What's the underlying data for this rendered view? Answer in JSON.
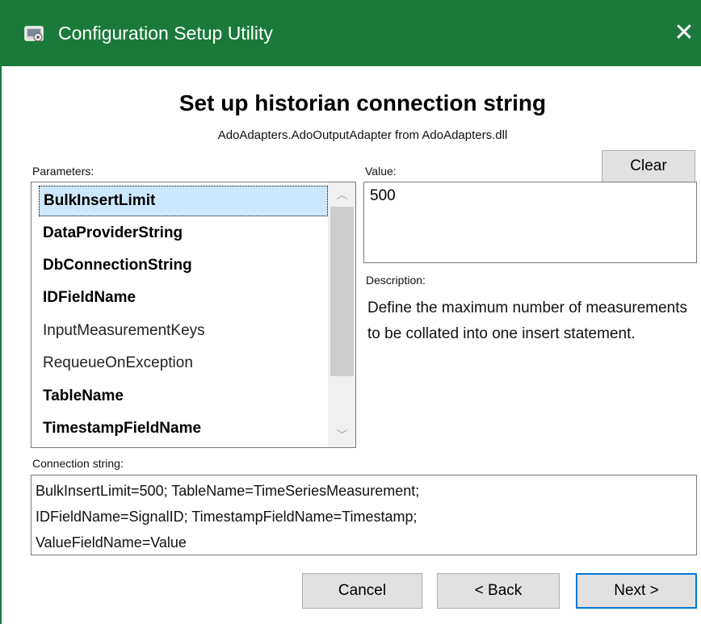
{
  "window": {
    "title": "Configuration Setup Utility",
    "close_glyph": "✕",
    "icon": "app-config-icon"
  },
  "page": {
    "heading": "Set up historian connection string",
    "subheading": "AdoAdapters.AdoOutputAdapter from AdoAdapters.dll"
  },
  "parameters": {
    "label": "Parameters:",
    "items": [
      {
        "label": "BulkInsertLimit",
        "bold": true,
        "selected": true
      },
      {
        "label": "DataProviderString",
        "bold": true,
        "selected": false
      },
      {
        "label": "DbConnectionString",
        "bold": true,
        "selected": false
      },
      {
        "label": "IDFieldName",
        "bold": true,
        "selected": false
      },
      {
        "label": "InputMeasurementKeys",
        "bold": false,
        "selected": false
      },
      {
        "label": "RequeueOnException",
        "bold": false,
        "selected": false
      },
      {
        "label": "TableName",
        "bold": true,
        "selected": false
      },
      {
        "label": "TimestampFieldName",
        "bold": true,
        "selected": false
      }
    ]
  },
  "value": {
    "label": "Value:",
    "text": "500"
  },
  "clear_button": "Clear",
  "description": {
    "label": "Description:",
    "text": "Define the maximum number of measurements to be collated into one insert statement."
  },
  "connection_string": {
    "label": "Connection string:",
    "lines": [
      "BulkInsertLimit=500; TableName=TimeSeriesMeasurement;",
      "IDFieldName=SignalID; TimestampFieldName=Timestamp;",
      "ValueFieldName=Value"
    ]
  },
  "footer": {
    "cancel": "Cancel",
    "back": "< Back",
    "next": "Next >"
  },
  "colors": {
    "titlebar": "#1b7a3a",
    "selection": "#cce8ff",
    "default_button_border": "#0078d7"
  }
}
